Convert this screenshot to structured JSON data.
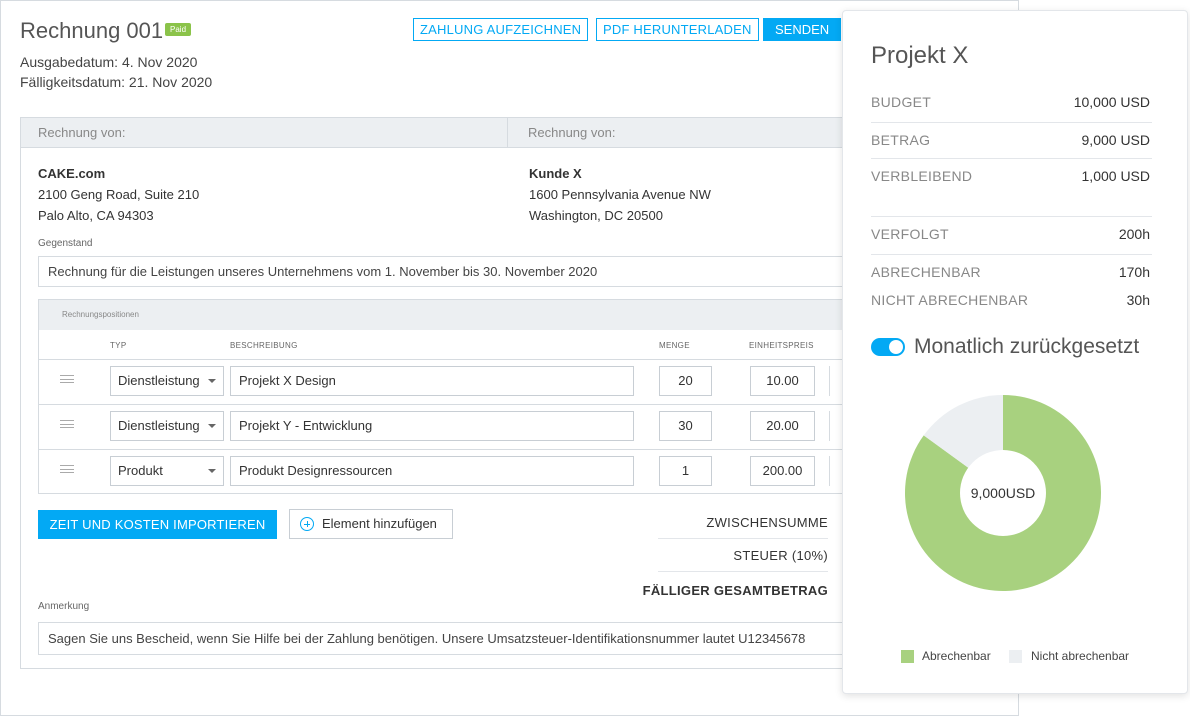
{
  "invoice": {
    "title": "Rechnung 001",
    "status_badge": "Paid",
    "issue_date": "Ausgabedatum: 4. Nov 2020",
    "due_date": "Fälligkeitsdatum: 21. Nov 2020",
    "actions": {
      "record_payment": "ZAHLUNG AUFZEICHNEN",
      "download_pdf": "PDF HERUNTERLADEN",
      "send": "SENDEN"
    },
    "from_header": "Rechnung von:",
    "to_header": "Rechnung von:",
    "from": {
      "name": "CAKE.com",
      "line1": "2100 Geng Road, Suite 210",
      "line2": "Palo Alto, CA 94303"
    },
    "to": {
      "name": "Kunde X",
      "line1": "1600 Pennsylvania Avenue NW",
      "line2": "Washington, DC 20500"
    },
    "subject_label": "Gegenstand",
    "subject_value": "Rechnung für die Leistungen unseres Unternehmens vom 1. November bis 30. November 2020",
    "items_header": "Rechnungspositionen",
    "columns": {
      "type": "TYP",
      "description": "BESCHREIBUNG",
      "quantity": "MENGE",
      "unit_price": "EINHEITSPREIS"
    },
    "items": [
      {
        "type": "Dienstleistung",
        "description": "Projekt X Design",
        "quantity": "20",
        "unit_price": "10.00"
      },
      {
        "type": "Dienstleistung",
        "description": "Projekt Y - Entwicklung",
        "quantity": "30",
        "unit_price": "20.00"
      },
      {
        "type": "Produkt",
        "description": "Produkt  Designressourcen",
        "quantity": "1",
        "unit_price": "200.00"
      }
    ],
    "import_button": "ZEIT UND KOSTEN  IMPORTIEREN",
    "add_item_button": "Element hinzufügen",
    "totals": {
      "subtotal": "ZWISCHENSUMME",
      "tax": "STEUER  (10%)",
      "total_due": "FÄLLIGER GESAMTBETRAG"
    },
    "note_label": "Anmerkung",
    "note_value": "Sagen Sie uns Bescheid, wenn Sie Hilfe bei der Zahlung benötigen. Unsere Umsatzsteuer-Identifikationsnummer lautet U12345678"
  },
  "project": {
    "title": "Projekt X",
    "budget_label": "BUDGET",
    "budget_value": "10,000 USD",
    "amount_label": "BETRAG",
    "amount_value": "9,000 USD",
    "remaining_label": "VERBLEIBEND",
    "remaining_value": "1,000 USD",
    "tracked_label": "VERFOLGT",
    "tracked_value": "200h",
    "billable_label": "ABRECHENBAR",
    "billable_value": "170h",
    "nonbillable_label": "NICHT ABRECHENBAR",
    "nonbillable_value": "30h",
    "toggle_label": "Monatlich zurückgesetzt",
    "toggle_on": true
  },
  "chart_data": {
    "type": "pie",
    "center_label": "9,000USD",
    "categories": [
      "Abrechenbar",
      "Nicht abrechenbar"
    ],
    "values": [
      170,
      30
    ],
    "colors": [
      "#a8d17f",
      "#eceff2"
    ]
  }
}
